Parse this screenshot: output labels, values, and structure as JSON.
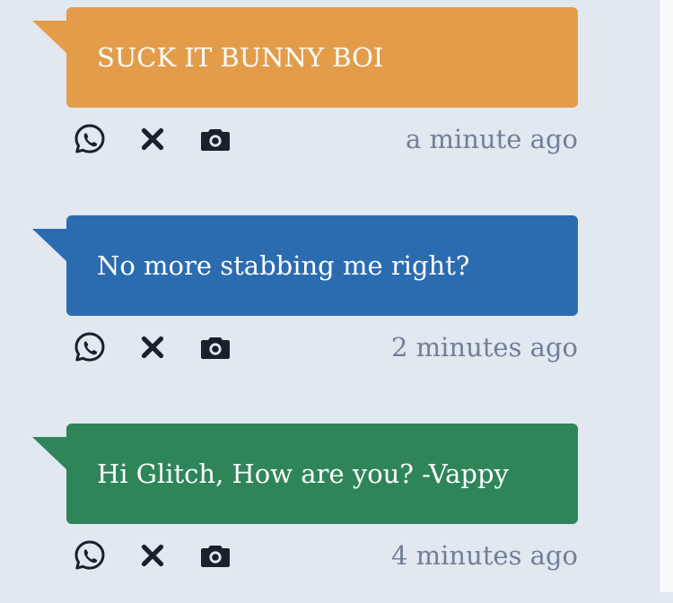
{
  "messages": [
    {
      "text": "SUCK IT BUNNY BOI",
      "color": "#e39d4a",
      "time": "a minute ago"
    },
    {
      "text": "No more stabbing me right?",
      "color": "#2b6cb0",
      "time": "2 minutes ago"
    },
    {
      "text": "Hi Glitch, How are you? -Vappy",
      "color": "#2f855a",
      "time": "4 minutes ago"
    }
  ],
  "actions": {
    "share_icon": "whatsapp-icon",
    "delete_icon": "close-icon",
    "screenshot_icon": "camera-icon"
  }
}
